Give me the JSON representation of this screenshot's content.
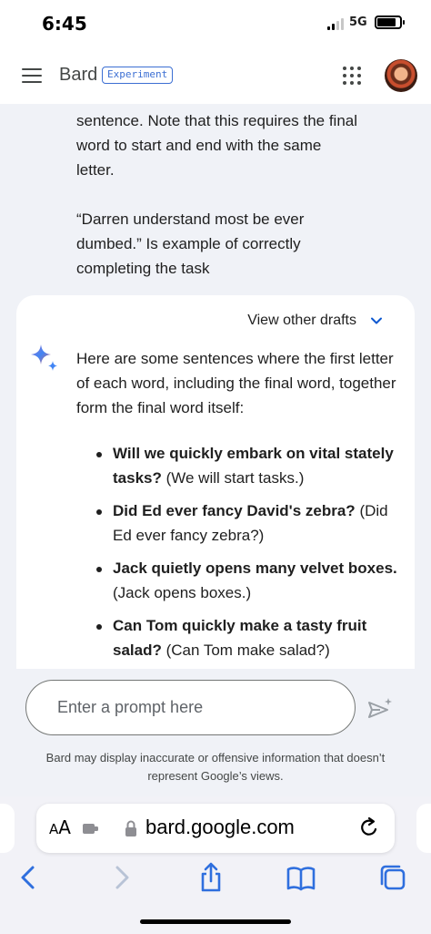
{
  "status_bar": {
    "time": "6:45",
    "network": "5G",
    "battery_level": 0.85
  },
  "header": {
    "title": "Bard",
    "badge": "Experiment",
    "icons": [
      "menu-icon",
      "apps-grid-icon",
      "avatar"
    ]
  },
  "conversation": {
    "prompt_paragraphs": [
      "sentence. Note that this requires the final word to start and end with the same letter.",
      "“Darren understand most be ever dumbed.” Is example of correctly completing the task"
    ],
    "response": {
      "drafts_label": "View other drafts",
      "intro": "Here are some sentences where the first letter of each word, including the final word, together form the final word itself:",
      "items": [
        {
          "sentence": "Will we quickly embark on vital stately tasks?",
          "note": "(We will start tasks.)"
        },
        {
          "sentence": "Did Ed ever fancy David's zebra?",
          "note": "(Did Ed ever fancy zebra?)"
        },
        {
          "sentence": "Jack quietly opens many velvet boxes.",
          "note": "(Jack opens boxes.)"
        },
        {
          "sentence": "Can Tom quickly make a tasty fruit salad?",
          "note": "(Can Tom make salad?)"
        }
      ]
    }
  },
  "input": {
    "placeholder": "Enter a prompt here",
    "disclaimer": "Bard may display inaccurate or offensive information that doesn’t represent Google’s views."
  },
  "browser": {
    "aa_label_big": "A",
    "aa_label_small": "A",
    "url": "bard.google.com",
    "toolbar": [
      "back-icon",
      "forward-icon",
      "share-icon",
      "bookmarks-icon",
      "tabs-icon"
    ]
  },
  "colors": {
    "accent": "#0b57d0",
    "badge": "#3c6fd3",
    "background": "#f0f2f7"
  }
}
